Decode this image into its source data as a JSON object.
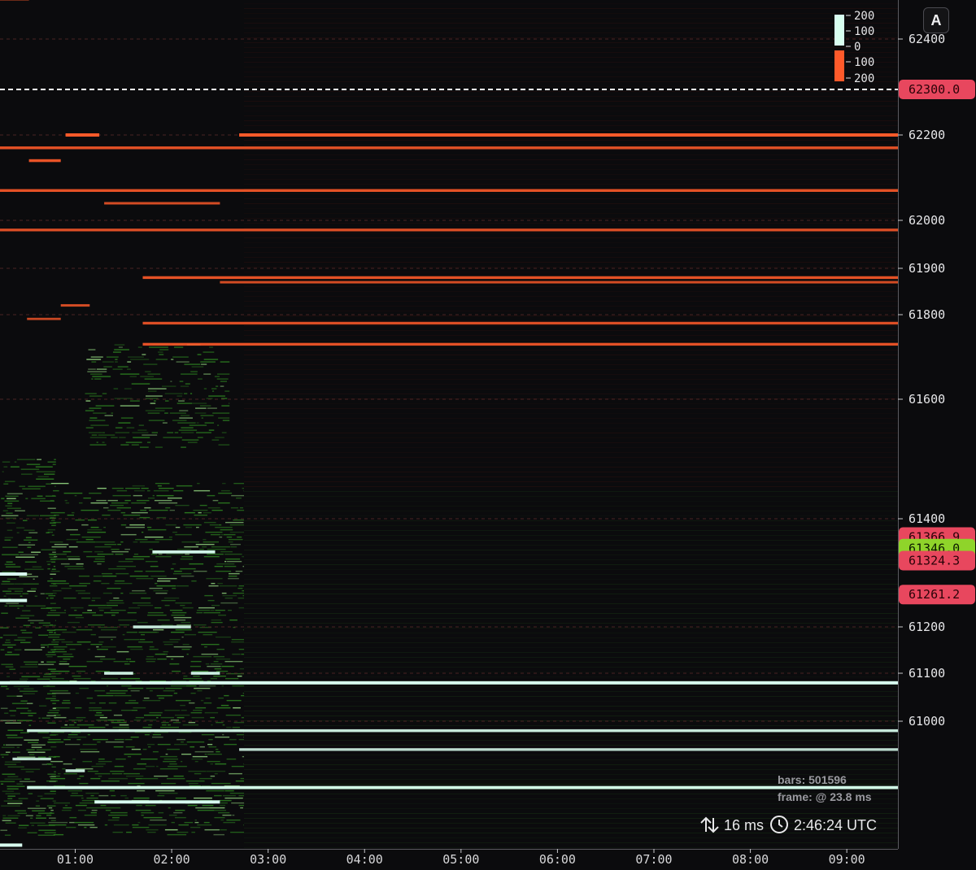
{
  "chart_data": {
    "type": "heatmap",
    "y_axis": {
      "ticks": [
        62400,
        62200,
        62000,
        61900,
        61800,
        61600,
        61400,
        61200,
        61100,
        61000
      ],
      "anchors": [
        [
          62400,
          48
        ],
        [
          62300,
          110
        ],
        [
          62200,
          166
        ],
        [
          62000,
          271
        ],
        [
          61900,
          330
        ],
        [
          61800,
          387
        ],
        [
          61600,
          491
        ],
        [
          61400,
          638
        ],
        [
          61300,
          706
        ],
        [
          61200,
          771
        ],
        [
          61100,
          828
        ],
        [
          61000,
          887
        ],
        [
          60900,
          945
        ],
        [
          60800,
          1004
        ]
      ]
    },
    "x_axis": {
      "ticks": [
        "01:00",
        "02:00",
        "03:00",
        "04:00",
        "05:00",
        "06:00",
        "07:00",
        "08:00",
        "09:00"
      ],
      "tick_hours": [
        1,
        2,
        3,
        4,
        5,
        6,
        7,
        8,
        9
      ],
      "range_hours": [
        0.22,
        9.53
      ]
    },
    "legend": {
      "bid_labels": [
        "200",
        "100",
        "0"
      ],
      "ask_labels": [
        "100",
        "200"
      ],
      "bid_color": "#d8fff0",
      "ask_color": "#ff5a2a"
    },
    "ask_levels": [
      {
        "price": 62200,
        "start": 2.7,
        "end": 9.53,
        "size": 200
      },
      {
        "price": 62170,
        "start": 0.22,
        "end": 9.53,
        "size": 150
      },
      {
        "price": 62070,
        "start": 0.22,
        "end": 9.53,
        "size": 150
      },
      {
        "price": 61980,
        "start": 0.22,
        "end": 9.53,
        "size": 140
      },
      {
        "price": 61880,
        "start": 1.7,
        "end": 9.53,
        "size": 150
      },
      {
        "price": 61870,
        "start": 2.5,
        "end": 9.53,
        "size": 120
      },
      {
        "price": 61780,
        "start": 1.7,
        "end": 9.53,
        "size": 140
      },
      {
        "price": 61730,
        "start": 1.7,
        "end": 9.53,
        "size": 150
      },
      {
        "price": 62480,
        "start": 0.22,
        "end": 0.52,
        "size": 200
      },
      {
        "price": 62200,
        "start": 0.9,
        "end": 1.25,
        "size": 200
      },
      {
        "price": 62140,
        "start": 0.52,
        "end": 0.85,
        "size": 160
      },
      {
        "price": 62040,
        "start": 1.3,
        "end": 2.5,
        "size": 120
      },
      {
        "price": 61820,
        "start": 0.85,
        "end": 1.15,
        "size": 120
      },
      {
        "price": 61790,
        "start": 0.5,
        "end": 0.85,
        "size": 100
      }
    ],
    "bid_levels": [
      {
        "price": 61080,
        "start": 0.22,
        "end": 9.53,
        "size": 200
      },
      {
        "price": 60980,
        "start": 0.5,
        "end": 9.53,
        "size": 160
      },
      {
        "price": 60940,
        "start": 2.7,
        "end": 9.53,
        "size": 140
      },
      {
        "price": 60860,
        "start": 0.5,
        "end": 9.53,
        "size": 180
      },
      {
        "price": 60830,
        "start": 1.2,
        "end": 2.5,
        "size": 200
      },
      {
        "price": 61340,
        "start": 1.8,
        "end": 2.45,
        "size": 180
      },
      {
        "price": 61300,
        "start": 0.22,
        "end": 0.5,
        "size": 200
      },
      {
        "price": 61250,
        "start": 0.22,
        "end": 0.5,
        "size": 200
      },
      {
        "price": 61200,
        "start": 1.6,
        "end": 2.2,
        "size": 160
      },
      {
        "price": 61100,
        "start": 1.3,
        "end": 1.6,
        "size": 170
      },
      {
        "price": 61100,
        "start": 2.2,
        "end": 2.5,
        "size": 170
      },
      {
        "price": 60920,
        "start": 0.35,
        "end": 0.75,
        "size": 140
      },
      {
        "price": 60895,
        "start": 0.9,
        "end": 1.1,
        "size": 160
      },
      {
        "price": 60740,
        "start": 0.22,
        "end": 0.45,
        "size": 200
      }
    ],
    "bid_zones": [
      {
        "price_top": 61730,
        "price_bottom": 61520,
        "start": 1.1,
        "end": 2.6
      },
      {
        "price_top": 61460,
        "price_bottom": 60760,
        "start": 0.7,
        "end": 2.75
      },
      {
        "price_top": 61500,
        "price_bottom": 60760,
        "start": 0.22,
        "end": 0.8
      }
    ],
    "price_tags": [
      {
        "label": "62300.0",
        "price": 62300,
        "color": "#e8475e",
        "text_color": "#2a0308",
        "line": "#ffffff"
      },
      {
        "label": "61366.9",
        "price": 61366.9,
        "color": "#e8475e",
        "text_color": "#2a0308",
        "line": null
      },
      {
        "label": "61346.0",
        "price": 61346.0,
        "color": "#8fd42a",
        "text_color": "#0d1a00",
        "line": null
      },
      {
        "label": "61324.3",
        "price": 61324.3,
        "color": "#e8475e",
        "text_color": "#2a0308",
        "line": null
      },
      {
        "label": "61261.2",
        "price": 61261.2,
        "color": "#e8475e",
        "text_color": "#2a0308",
        "line": null
      }
    ]
  },
  "overlay": {
    "bars": "bars: 501596",
    "frame": "frame: @ 23.8 ms"
  },
  "status": {
    "latency": "16 ms",
    "clock": "2:46:24 UTC"
  },
  "controls": {
    "auto_label": "A"
  },
  "colors": {
    "background": "#0b0b0d",
    "grid": "#5a2a2a",
    "axis_line": "#5a5a60"
  }
}
